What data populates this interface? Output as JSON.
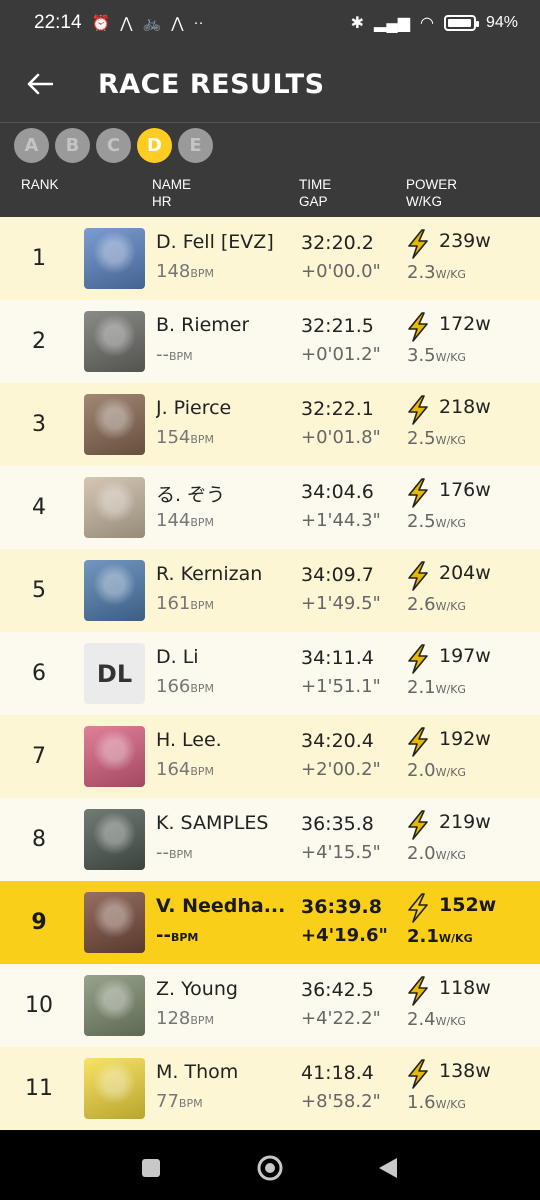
{
  "status": {
    "time": "22:14",
    "battery": "94%",
    "battery_level": 0.94
  },
  "header": {
    "title": "RACE RESULTS"
  },
  "categories": [
    {
      "label": "A",
      "active": false
    },
    {
      "label": "B",
      "active": false
    },
    {
      "label": "C",
      "active": false
    },
    {
      "label": "D",
      "active": true
    },
    {
      "label": "E",
      "active": false
    }
  ],
  "columns": {
    "rank": "RANK",
    "name": "NAME",
    "hr": "HR",
    "time": "TIME",
    "gap": "GAP",
    "power": "POWER",
    "wkg": "W/KG"
  },
  "units": {
    "bpm": "BPM",
    "wkg": "W/KG"
  },
  "colors": {
    "accent": "#f9cf1a",
    "header_bg": "#3a3a3a",
    "bolt": "#e6b800"
  },
  "results": [
    {
      "rank": "1",
      "name": "D. Fell [EVZ]",
      "hr": "148",
      "time": "32:20.2",
      "gap": "+0'00.0\"",
      "watts": "239w",
      "wkg": "2.3",
      "avatar": "photo-mountain-selfie",
      "avatar_color": "#5b84c4"
    },
    {
      "rank": "2",
      "name": "B. Riemer",
      "hr": "--",
      "time": "32:21.5",
      "gap": "+0'01.2\"",
      "watts": "172w",
      "wkg": "3.5",
      "avatar": "photo-cyclist",
      "avatar_color": "#6d6f6a"
    },
    {
      "rank": "3",
      "name": "J. Pierce",
      "hr": "154",
      "time": "32:22.1",
      "gap": "+0'01.8\"",
      "watts": "218w",
      "wkg": "2.5",
      "avatar": "photo-family",
      "avatar_color": "#8a6a52"
    },
    {
      "rank": "4",
      "name": "る. ぞう",
      "hr": "144",
      "time": "34:04.6",
      "gap": "+1'44.3\"",
      "watts": "176w",
      "wkg": "2.5",
      "avatar": "photo-dog",
      "avatar_color": "#c9b9a2"
    },
    {
      "rank": "5",
      "name": "R. Kernizan",
      "hr": "161",
      "time": "34:09.7",
      "gap": "+1'49.5\"",
      "watts": "204w",
      "wkg": "2.6",
      "avatar": "photo-street-ride",
      "avatar_color": "#4f7db0"
    },
    {
      "rank": "6",
      "name": "D. Li",
      "hr": "166",
      "time": "34:11.4",
      "gap": "+1'51.1\"",
      "watts": "197w",
      "wkg": "2.1",
      "avatar": "initials",
      "initials": "DL",
      "avatar_color": "#ebebeb"
    },
    {
      "rank": "7",
      "name": "H.  Lee.",
      "hr": "164",
      "time": "34:20.4",
      "gap": "+2'00.2\"",
      "watts": "192w",
      "wkg": "2.0",
      "avatar": "photo-indoor-cyclist",
      "avatar_color": "#d8607f"
    },
    {
      "rank": "8",
      "name": "K. SAMPLES",
      "hr": "--",
      "time": "36:35.8",
      "gap": "+4'15.5\"",
      "watts": "219w",
      "wkg": "2.0",
      "avatar": "photo-heart-graffiti",
      "avatar_color": "#4e5a52"
    },
    {
      "rank": "9",
      "name": "V. Needha...",
      "hr": "--",
      "time": "36:39.8",
      "gap": "+4'19.6\"",
      "watts": "152w",
      "wkg": "2.1",
      "avatar": "photo-helmet-rider",
      "avatar_color": "#7a4c3c",
      "highlight": true
    },
    {
      "rank": "10",
      "name": "Z. Young",
      "hr": "128",
      "time": "36:42.5",
      "gap": "+4'22.2\"",
      "watts": "118w",
      "wkg": "2.4",
      "avatar": "photo-cyclist-sunglasses",
      "avatar_color": "#7d8c70"
    },
    {
      "rank": "11",
      "name": "M. Thom",
      "hr": "77",
      "time": "41:18.4",
      "gap": "+8'58.2\"",
      "watts": "138w",
      "wkg": "1.6",
      "avatar": "cartoon-character",
      "avatar_color": "#f6dc3e"
    }
  ]
}
